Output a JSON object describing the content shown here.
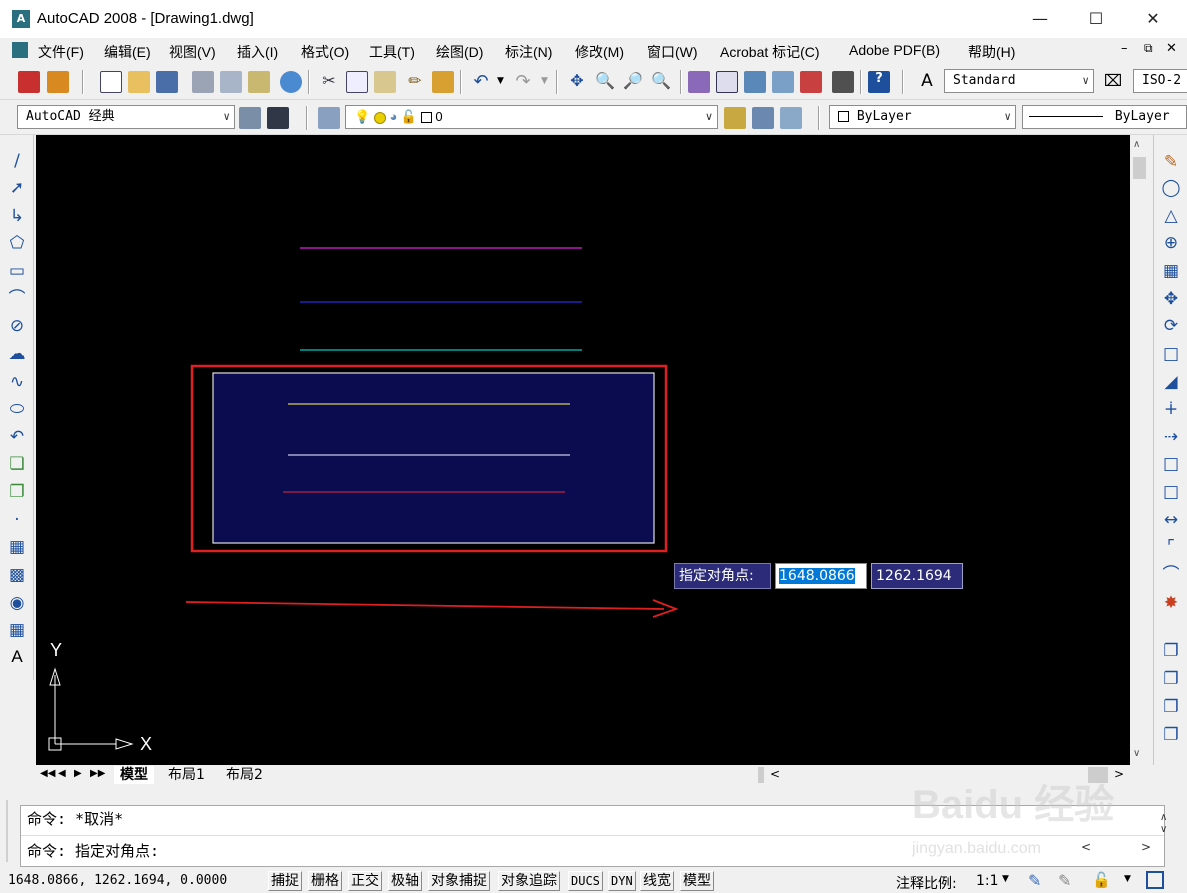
{
  "window": {
    "title": "AutoCAD 2008 - [Drawing1.dwg]",
    "app_icon": "autocad-icon"
  },
  "menu": [
    "文件(F)",
    "编辑(E)",
    "视图(V)",
    "插入(I)",
    "格式(O)",
    "工具(T)",
    "绘图(D)",
    "标注(N)",
    "修改(M)",
    "窗口(W)",
    "Acrobat 标记(C)",
    "Adobe PDF(B)",
    "帮助(H)"
  ],
  "toolbar": {
    "text_style": "Standard",
    "dim_style": "ISO-2",
    "workspace": "AutoCAD 经典",
    "layer": "0",
    "color": "ByLayer",
    "linetype": "ByLayer"
  },
  "tabs": [
    "模型",
    "布局1",
    "布局2"
  ],
  "dynamic_input": {
    "prompt": "指定对角点:",
    "x_value": "1648.0866",
    "y_value": "1262.1694"
  },
  "command": {
    "line1": "命令: *取消*",
    "line2": "命令: 指定对角点:"
  },
  "status": {
    "coords": "1648.0866, 1262.1694, 0.0000",
    "toggles": [
      "捕捉",
      "栅格",
      "正交",
      "极轴",
      "对象捕捉",
      "对象追踪",
      "DUCS",
      "DYN",
      "线宽",
      "模型"
    ],
    "annotation_scale_label": "注释比例:",
    "annotation_scale_value": "1:1"
  },
  "ucs": {
    "x_label": "X",
    "y_label": "Y"
  },
  "drawing": {
    "line_colors": [
      "#e020e0",
      "#2030e0",
      "#00c8c8",
      "#d0d060",
      "#c8c8e8",
      "#c02040"
    ],
    "selection_fill": "#0b0b50",
    "annotation_color": "#e02020"
  },
  "watermark": {
    "text": "Baidu 经验",
    "url": "jingyan.baidu.com"
  }
}
